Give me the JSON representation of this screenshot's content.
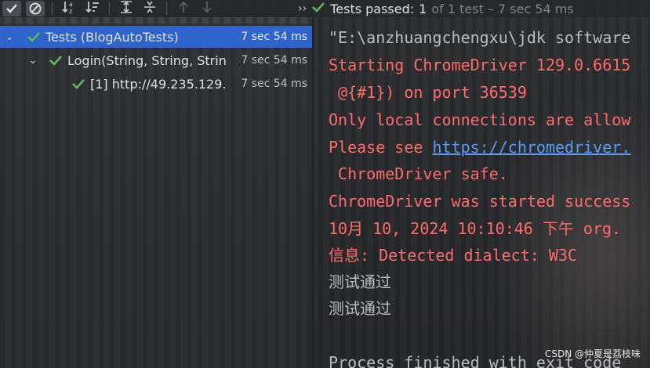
{
  "toolbar": {
    "buttons": [
      {
        "icon": "check-icon"
      },
      {
        "icon": "stop-icon"
      },
      {
        "icon": "sort-alpha-icon"
      },
      {
        "icon": "sort-duration-icon"
      },
      {
        "icon": "expand-all-icon"
      },
      {
        "icon": "collapse-all-icon"
      },
      {
        "icon": "arrow-up-icon"
      },
      {
        "icon": "arrow-down-icon"
      }
    ],
    "more_glyph": "››",
    "status_passed": "Tests passed:",
    "status_count": "1",
    "status_detail": "of 1 test – 7 sec 54 ms"
  },
  "tree": [
    {
      "label": "Tests (BlogAutoTests)",
      "duration": "7 sec 54 ms",
      "selected": true
    },
    {
      "label": "Login(String, String, Strin",
      "duration": "7 sec 54 ms",
      "selected": false
    },
    {
      "label": "[1] http://49.235.129.",
      "duration": "7 sec 54 ms",
      "selected": false
    }
  ],
  "console": {
    "path_line": "\"E:\\anzhuangchengxu\\jdk software",
    "lines": [
      {
        "text": "Starting ChromeDriver 129.0.6615",
        "color": "red"
      },
      {
        "text": " @{#1}) on port 36539",
        "color": "red"
      },
      {
        "text": "Only local connections are allow",
        "color": "red"
      },
      {
        "prefix": "Please see ",
        "link": "https://chromedriver.",
        "color": "red"
      },
      {
        "text": " ChromeDriver safe.",
        "color": "red"
      },
      {
        "text": "ChromeDriver was started success",
        "color": "red"
      },
      {
        "text": "10月 10, 2024 10:10:46 下午 org.",
        "color": "red"
      },
      {
        "text": "信息: Detected dialect: W3C",
        "color": "red"
      },
      {
        "text": "测试通过",
        "color": "gray"
      },
      {
        "text": "测试通过",
        "color": "gray"
      },
      {
        "text": "Process finished with exit code",
        "color": "gray"
      }
    ]
  },
  "watermark": "CSDN @仲夏是荔枝味",
  "colors": {
    "accent_selection": "#2f65ca",
    "pass_green": "#5fb85f",
    "error_red": "#ff6b6b",
    "link_blue": "#589df6"
  }
}
